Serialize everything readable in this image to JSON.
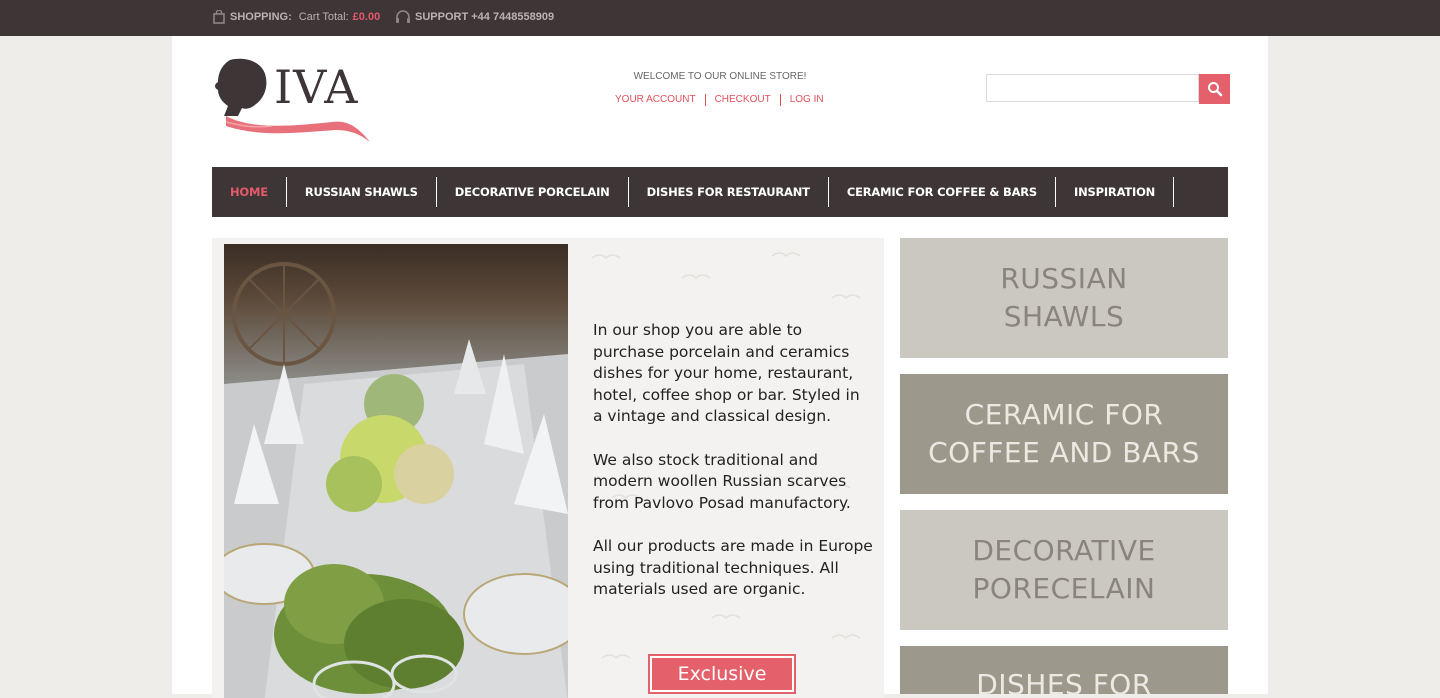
{
  "topbar": {
    "shopping_label": "SHOPPING:",
    "cart_total_label": "Cart Total:",
    "cart_total_value": "£0.00",
    "support_label": "SUPPORT +44 7448558909"
  },
  "header": {
    "logo_text": "IVA",
    "welcome": "WELCOME TO OUR ONLINE STORE!",
    "links": [
      "YOUR ACCOUNT",
      "CHECKOUT",
      "LOG IN"
    ],
    "search_value": ""
  },
  "nav": {
    "tabs": [
      "HOME",
      "RUSSIAN SHAWLS",
      "DECORATIVE PORCELAIN",
      "DISHES FOR RESTAURANT",
      "CERAMIC FOR COFFEE & BARS",
      "INSPIRATION"
    ],
    "active": "HOME"
  },
  "hero": {
    "paragraphs": [
      "In our shop you are able to purchase porcelain and ceramics dishes for your home, restaurant, hotel, coffee shop or bar. Styled in a vintage and classical design.",
      "We also stock traditional and modern  woollen Russian scarves from Pavlovo Posad manufactory.",
      "All our products are made in Europe using traditional techniques. All materials used are organic."
    ],
    "button_label": "Exclusive"
  },
  "categories": [
    {
      "line1": "RUSSIAN",
      "line2": "SHAWLS"
    },
    {
      "line1": "CERAMIC FOR",
      "line2": "COFFEE AND BARS"
    },
    {
      "line1": "DECORATIVE",
      "line2": "PORECELAIN"
    },
    {
      "line1": "DISHES FOR",
      "line2": ""
    }
  ],
  "colors": {
    "brand_dark": "#3e3537",
    "accent": "#e4606b",
    "tile_light": "#cbc8bf",
    "tile_dark": "#9c988b"
  }
}
